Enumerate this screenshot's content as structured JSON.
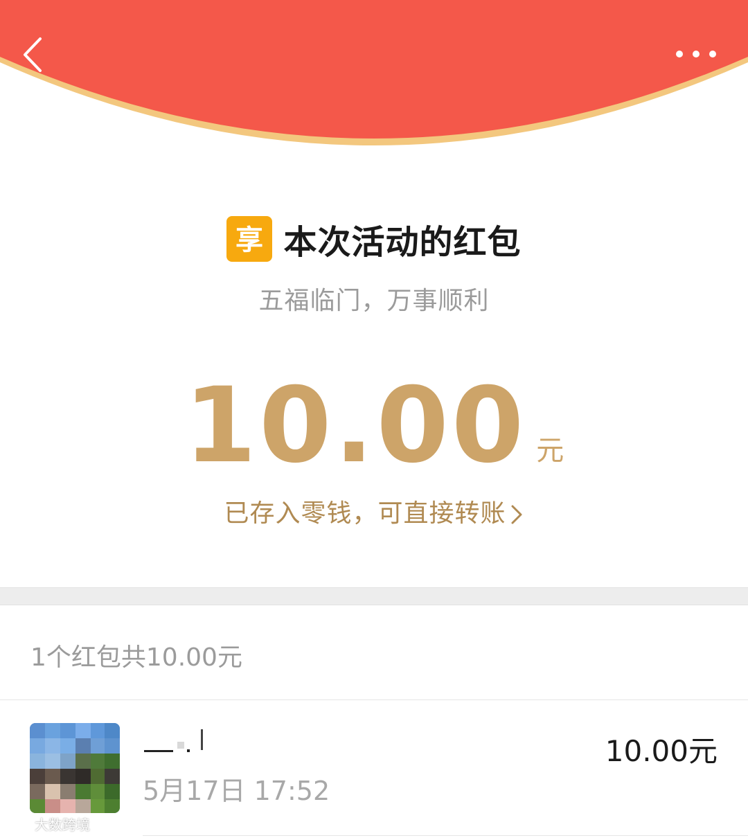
{
  "colors": {
    "header_red": "#f4584a",
    "header_rim": "#f3c77e",
    "gold": "#cda469",
    "link_gold": "#b08a52",
    "brand_icon": "#f7a90f"
  },
  "header": {
    "back_icon": "chevron-left-icon",
    "more_icon": "more-dots-icon"
  },
  "packet": {
    "brand_icon_char": "享",
    "title": "本次活动的红包",
    "blessing": "五福临门，万事顺利",
    "amount": "10.00",
    "unit": "元",
    "wallet_link": "已存入零钱，可直接转账"
  },
  "summary": {
    "text": "1个红包共10.00元"
  },
  "records": [
    {
      "time": "5月17日  17:52",
      "amount": "10.00元"
    }
  ],
  "watermark": {
    "text": "大数跨境"
  }
}
